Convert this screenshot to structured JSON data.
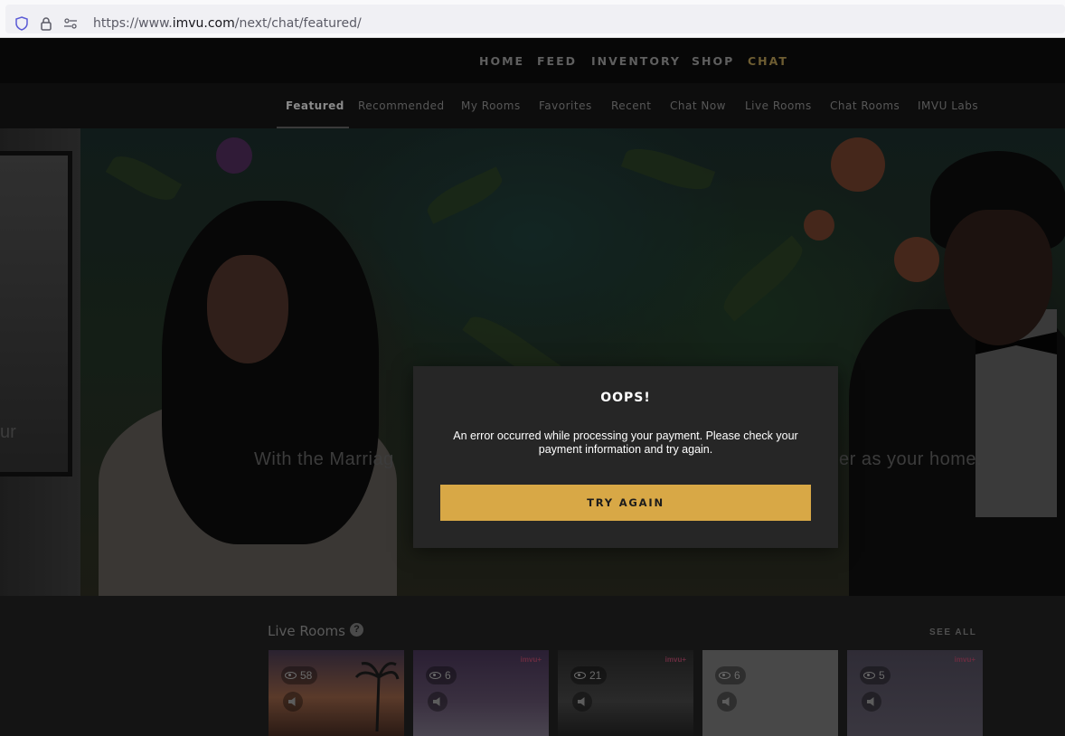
{
  "browser": {
    "url_prefix": "https://www.",
    "url_domain": "imvu.com",
    "url_path": "/next/chat/featured/",
    "icons": [
      "shield-icon",
      "lock-icon",
      "permissions-icon"
    ]
  },
  "topnav": {
    "items": [
      "HOME",
      "FEED",
      "INVENTORY",
      "SHOP",
      "CHAT"
    ],
    "active": "CHAT"
  },
  "subnav": {
    "tabs": [
      "Featured",
      "Recommended",
      "My Rooms",
      "Favorites",
      "Recent",
      "Chat Now",
      "Live Rooms",
      "Chat Rooms",
      "IMVU Labs"
    ],
    "active": "Featured"
  },
  "hero": {
    "left_peek_text": "ur",
    "caption_left": "With the Marriag",
    "caption_right": "er as your home."
  },
  "live_rooms": {
    "title": "Live Rooms",
    "help_glyph": "?",
    "see_all": "SEE ALL",
    "cards": [
      {
        "views": "58",
        "badge": ""
      },
      {
        "views": "6",
        "badge": "imvu+"
      },
      {
        "views": "21",
        "badge": "imvu+"
      },
      {
        "views": "6",
        "badge": ""
      },
      {
        "views": "5",
        "badge": "imvu+"
      }
    ]
  },
  "modal": {
    "title": "OOPS!",
    "message": "An error occurred while processing your payment. Please check your payment information and try again.",
    "button": "TRY AGAIN"
  },
  "colors": {
    "accent": "#d8a846",
    "modal_bg": "#262626",
    "page_bg": "#141414"
  }
}
